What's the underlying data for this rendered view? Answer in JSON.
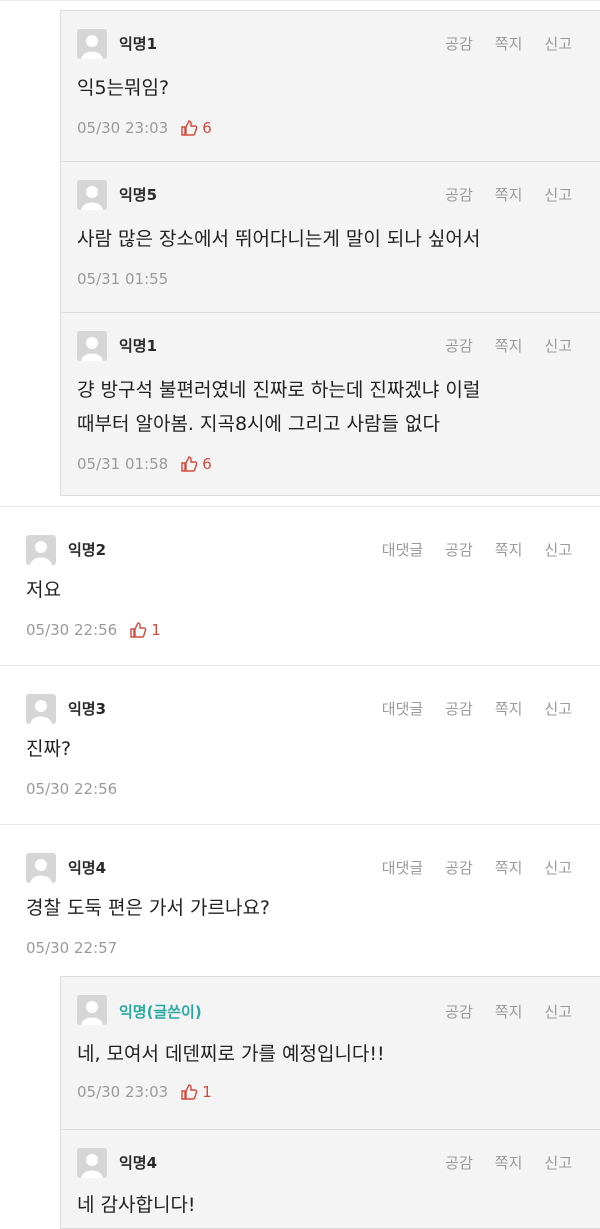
{
  "actions": {
    "reply": "대댓글",
    "like": "공감",
    "message": "쪽지",
    "report": "신고"
  },
  "items": [
    {
      "name": "익명1",
      "text": "익5는뭐임?",
      "time": "05/30 23:03",
      "likes": "6"
    },
    {
      "name": "익명5",
      "text": "사람 많은 장소에서 뛰어다니는게 말이 되나 싶어서",
      "time": "05/31 01:55",
      "likes": ""
    },
    {
      "name": "익명1",
      "text": "걍 방구석 불편러였네 진짜로 하는데 진짜겠냐 이럴\n때부터 알아봄. 지곡8시에 그리고 사람들 없다",
      "time": "05/31 01:58",
      "likes": "6"
    },
    {
      "name": "익명2",
      "text": "저요",
      "time": "05/30 22:56",
      "likes": "1"
    },
    {
      "name": "익명3",
      "text": "진짜?",
      "time": "05/30 22:56",
      "likes": ""
    },
    {
      "name": "익명4",
      "text": "경찰 도둑 편은 가서 가르나요?",
      "time": "05/30 22:57",
      "likes": ""
    },
    {
      "name": "익명(글쓴이)",
      "text": "네, 모여서 데덴찌로 가를 예정입니다!!",
      "time": "05/30 23:03",
      "likes": "1"
    },
    {
      "name": "익명4",
      "text": "네 감사합니다!",
      "time": "",
      "likes": ""
    }
  ]
}
